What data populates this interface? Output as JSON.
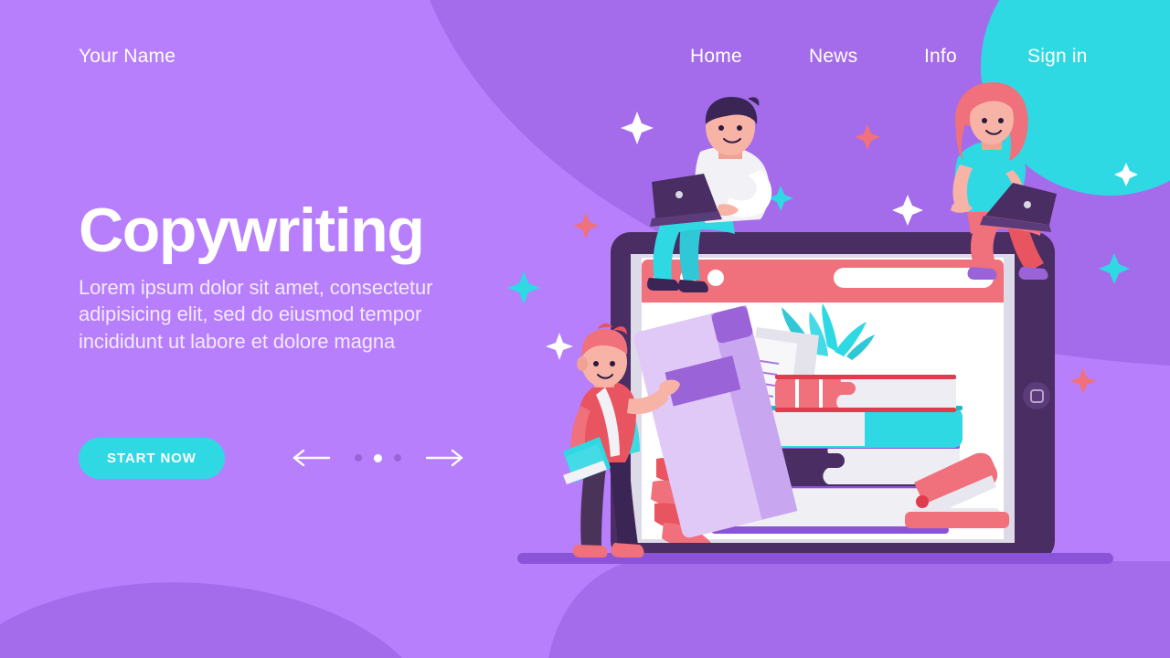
{
  "brand": {
    "name": "Your Name"
  },
  "nav": {
    "items": [
      {
        "label": "Home",
        "name": "nav-home"
      },
      {
        "label": "News",
        "name": "nav-news"
      },
      {
        "label": "Info",
        "name": "nav-info"
      },
      {
        "label": "Sign in",
        "name": "nav-signin"
      }
    ]
  },
  "hero": {
    "title": "Copywriting",
    "subtitle": "Lorem ipsum dolor sit amet, consectetur adipisicing elit, sed do eiusmod tempor incididunt ut labore et dolore magna"
  },
  "cta": {
    "button_label": "START NOW",
    "prev_icon": "arrow-left-icon",
    "next_icon": "arrow-right-icon",
    "dots": [
      {
        "active": false
      },
      {
        "active": true
      },
      {
        "active": false
      }
    ]
  },
  "illustration": {
    "name": "copywriting-hero-illustration",
    "description": "Tablet showing a browser window with a stack of books, quill feathers and a stapler; a man and a woman with laptops sit on the tablet edge; a boy with a backpack stands in front.",
    "browser": {
      "dots_count": 3,
      "url_bar": ""
    },
    "characters": [
      {
        "name": "man-with-laptop",
        "position": "tablet-top-left"
      },
      {
        "name": "woman-with-laptop",
        "position": "tablet-top-right"
      },
      {
        "name": "boy-with-backpack",
        "position": "tablet-bottom-left"
      }
    ],
    "objects": [
      "book-stack",
      "quill-feather",
      "red-feather",
      "papers",
      "stapler",
      "tilted-book",
      "tablet-home-button"
    ]
  },
  "colors": {
    "background_purple": "#b77ffc",
    "blob_purple": "#a46ceb",
    "accent_cyan": "#2fd9e3",
    "accent_coral": "#f0707c",
    "dark_purple": "#4a2d63",
    "white": "#ffffff",
    "dot_inactive": "#9a63d8"
  }
}
